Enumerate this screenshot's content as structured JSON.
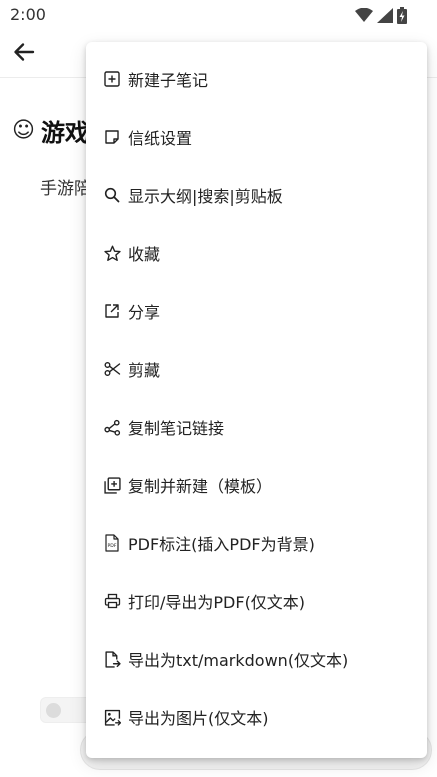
{
  "status_bar": {
    "time": "2:00",
    "icons": [
      "wifi-icon",
      "cellular-signal-icon",
      "battery-charging-icon"
    ]
  },
  "toolbar": {
    "back_icon": "arrow-left-icon"
  },
  "note": {
    "title_emoji": "☺",
    "title": "游戏",
    "body": "手游陪"
  },
  "menu": {
    "items": [
      {
        "label": "新建子笔记",
        "icon": "plus-square-icon"
      },
      {
        "label": "信纸设置",
        "icon": "sticky-note-icon"
      },
      {
        "label": "显示大纲|搜索|剪贴板",
        "icon": "search-icon"
      },
      {
        "label": "收藏",
        "icon": "star-icon"
      },
      {
        "label": "分享",
        "icon": "share-external-icon"
      },
      {
        "label": "剪藏",
        "icon": "scissors-icon"
      },
      {
        "label": "复制笔记链接",
        "icon": "link-nodes-icon"
      },
      {
        "label": "复制并新建（模板）",
        "icon": "copy-plus-icon"
      },
      {
        "label": "PDF标注(插入PDF为背景)",
        "icon": "pdf-file-icon"
      },
      {
        "label": "打印/导出为PDF(仅文本)",
        "icon": "printer-icon"
      },
      {
        "label": "导出为txt/markdown(仅文本)",
        "icon": "file-export-icon"
      },
      {
        "label": "导出为图片(仅文本)",
        "icon": "image-export-icon"
      }
    ]
  }
}
